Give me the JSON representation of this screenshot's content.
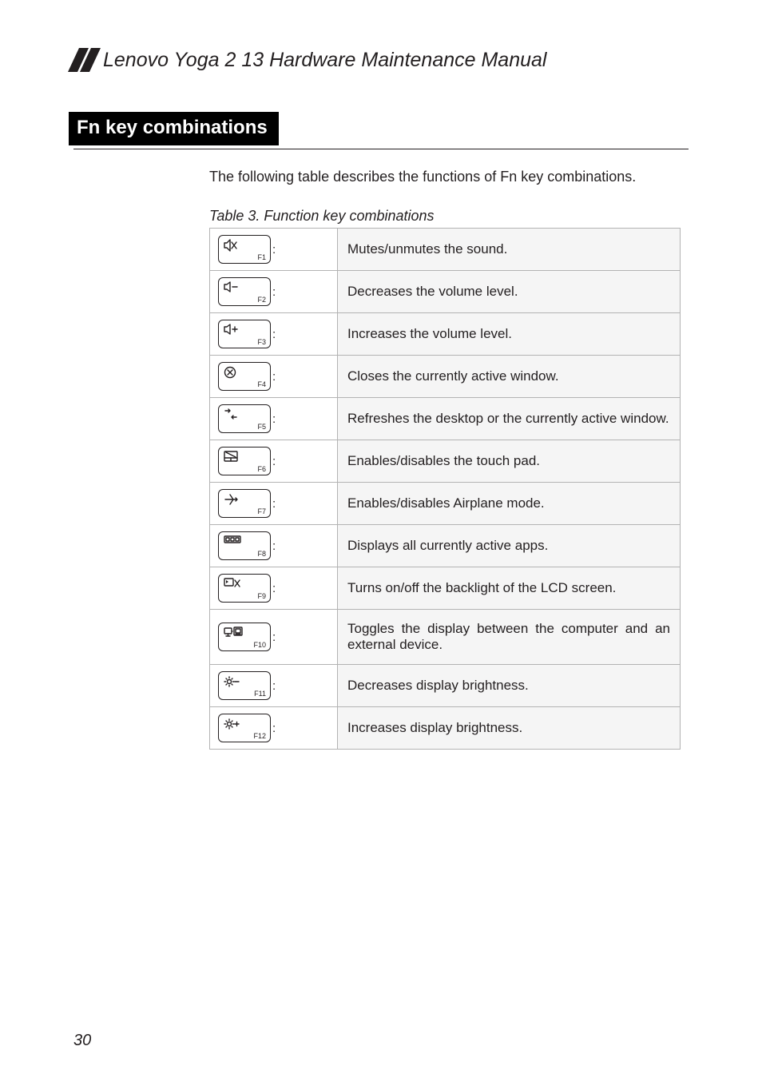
{
  "header": {
    "doc_title": "Lenovo Yoga 2 13 Hardware Maintenance Manual"
  },
  "section": {
    "title": "Fn key combinations",
    "intro": "The following table describes the functions of Fn key combinations.",
    "table_caption": "Table 3. Function key combinations"
  },
  "rows": [
    {
      "flabel": "F1",
      "icon": "mute-icon",
      "desc": "Mutes/unmutes the sound."
    },
    {
      "flabel": "F2",
      "icon": "volume-down-icon",
      "desc": "Decreases the volume level."
    },
    {
      "flabel": "F3",
      "icon": "volume-up-icon",
      "desc": "Increases the volume level."
    },
    {
      "flabel": "F4",
      "icon": "close-window-icon",
      "desc": "Closes the currently active window."
    },
    {
      "flabel": "F5",
      "icon": "refresh-icon",
      "desc": "Refreshes the desktop or the currently active window."
    },
    {
      "flabel": "F6",
      "icon": "touchpad-icon",
      "desc": "Enables/disables the touch pad."
    },
    {
      "flabel": "F7",
      "icon": "airplane-icon",
      "desc": "Enables/disables Airplane mode."
    },
    {
      "flabel": "F8",
      "icon": "apps-icon",
      "desc": "Displays all currently active apps."
    },
    {
      "flabel": "F9",
      "icon": "backlight-off-icon",
      "desc": "Turns on/off the backlight of the LCD screen."
    },
    {
      "flabel": "F10",
      "icon": "display-toggle-icon",
      "desc": "Toggles the display between the computer and an external device."
    },
    {
      "flabel": "F11",
      "icon": "brightness-down-icon",
      "desc": "Decreases display brightness."
    },
    {
      "flabel": "F12",
      "icon": "brightness-up-icon",
      "desc": "Increases display brightness."
    }
  ],
  "page_number": "30"
}
